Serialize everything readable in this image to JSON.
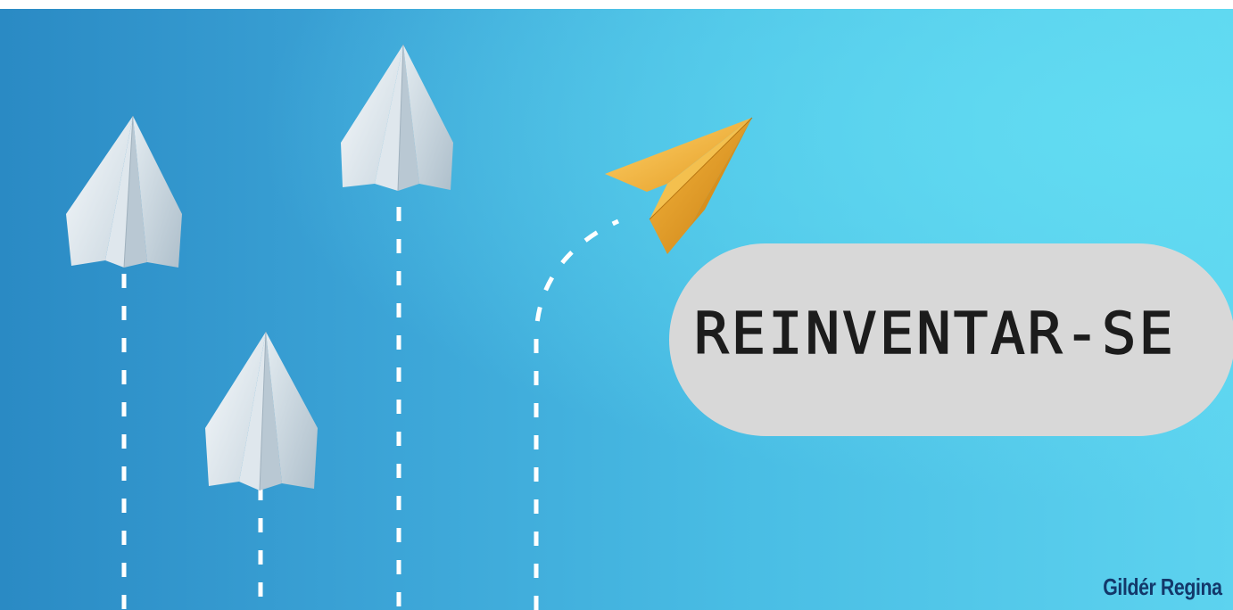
{
  "banner": {
    "headline": "REINVENTAR-SE",
    "author": "Gildér Regina"
  },
  "colors": {
    "background_left": "#2a8ac4",
    "background_right": "#5dd3ef",
    "paper_plane_white": "#eef3f6",
    "paper_plane_gold": "#f2b53a",
    "trail": "#ffffff",
    "pill": "#d8d8d8",
    "headline_text": "#1c1c1c",
    "author_text": "#13386a"
  },
  "icons": {
    "white_planes": [
      "paper-plane-icon",
      "paper-plane-icon",
      "paper-plane-icon"
    ],
    "gold_plane": "gold-paper-plane-icon",
    "trails": "dashed-trail"
  }
}
